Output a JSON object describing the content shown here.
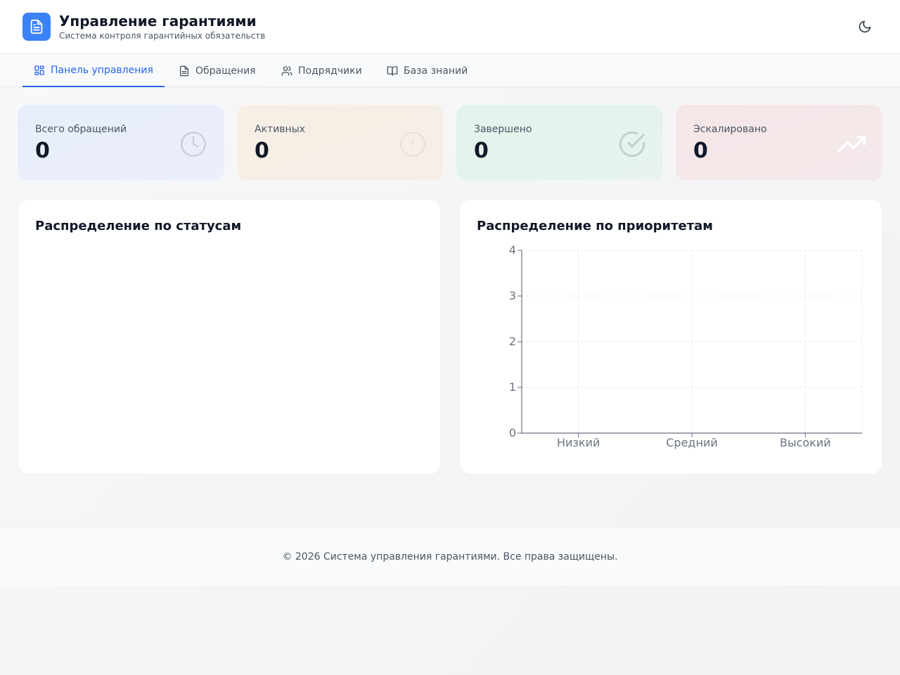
{
  "header": {
    "title": "Управление гарантиями",
    "subtitle": "Система контроля гарантийных обязательств",
    "logo_icon": "document-icon",
    "theme_toggle_icon": "moon-icon",
    "accent_color": "#3b82f6"
  },
  "nav": {
    "tabs": [
      {
        "label": "Панель управления",
        "icon": "dashboard-icon",
        "active": true
      },
      {
        "label": "Обращения",
        "icon": "document-icon",
        "active": false
      },
      {
        "label": "Подрядчики",
        "icon": "users-icon",
        "active": false
      },
      {
        "label": "База знаний",
        "icon": "book-icon",
        "active": false
      }
    ]
  },
  "stats": [
    {
      "label": "Всего обращений",
      "value": "0",
      "icon": "clock-icon"
    },
    {
      "label": "Активных",
      "value": "0",
      "icon": "alert-circle-icon"
    },
    {
      "label": "Завершено",
      "value": "0",
      "icon": "check-circle-icon"
    },
    {
      "label": "Эскалировано",
      "value": "0",
      "icon": "trending-up-icon"
    }
  ],
  "panels": {
    "status": {
      "title": "Распределение по статусам"
    },
    "priority": {
      "title": "Распределение по приоритетам"
    }
  },
  "chart_data": {
    "type": "bar",
    "categories": [
      "Низкий",
      "Средний",
      "Высокий"
    ],
    "values": [
      0,
      0,
      0
    ],
    "yticks": [
      "0",
      "1",
      "2",
      "3",
      "4"
    ],
    "ylim": [
      0,
      4
    ],
    "grid": true,
    "title": "Распределение по приоритетам",
    "xlabel": "",
    "ylabel": ""
  },
  "footer": {
    "text": "© 2026 Система управления гарантиями. Все права защищены."
  }
}
